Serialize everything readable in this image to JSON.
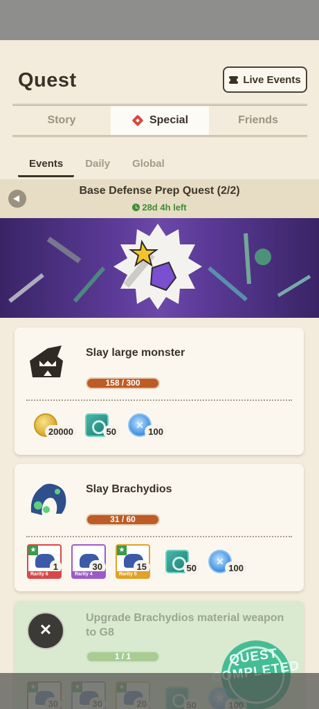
{
  "header": {
    "title": "Quest",
    "live_events_label": "Live Events"
  },
  "main_tabs": [
    {
      "label": "Story",
      "active": false
    },
    {
      "label": "Special",
      "active": true
    },
    {
      "label": "Friends",
      "active": false
    }
  ],
  "sub_tabs": [
    {
      "label": "Events",
      "active": true
    },
    {
      "label": "Daily",
      "active": false
    },
    {
      "label": "Global",
      "active": false
    }
  ],
  "event": {
    "title": "Base Defense Prep Quest (2/2)",
    "time_left": "28d 4h left"
  },
  "quests": [
    {
      "title": "Slay large monster",
      "progress": "158 / 300",
      "rewards": [
        {
          "icon": "zenny-coin-icon",
          "qty": "20000"
        },
        {
          "icon": "armor-sphere-icon",
          "qty": "50"
        },
        {
          "icon": "hunter-orb-icon",
          "qty": "100"
        }
      ]
    },
    {
      "title": "Slay Brachydios",
      "progress": "31 / 60",
      "rewards": [
        {
          "icon": "brachydios-material-icon",
          "rarity": "Rarity 6",
          "qty": "1"
        },
        {
          "icon": "brachydios-material-icon",
          "rarity": "Rarity 4",
          "qty": "30"
        },
        {
          "icon": "brachydios-material-icon",
          "rarity": "Rarity 5",
          "qty": "15"
        },
        {
          "icon": "armor-sphere-icon",
          "qty": "50"
        },
        {
          "icon": "hunter-orb-icon",
          "qty": "100"
        }
      ]
    },
    {
      "title": "Upgrade Brachydios material weapon to G8",
      "progress": "1 / 1",
      "status": "QUEST COMPLETED",
      "rewards_partial": [
        "30",
        "30",
        "20",
        "50",
        "100"
      ]
    }
  ],
  "colors": {
    "accent_red": "#d8473e",
    "progress_orange": "#bd5c26",
    "time_green": "#3f8d36"
  }
}
